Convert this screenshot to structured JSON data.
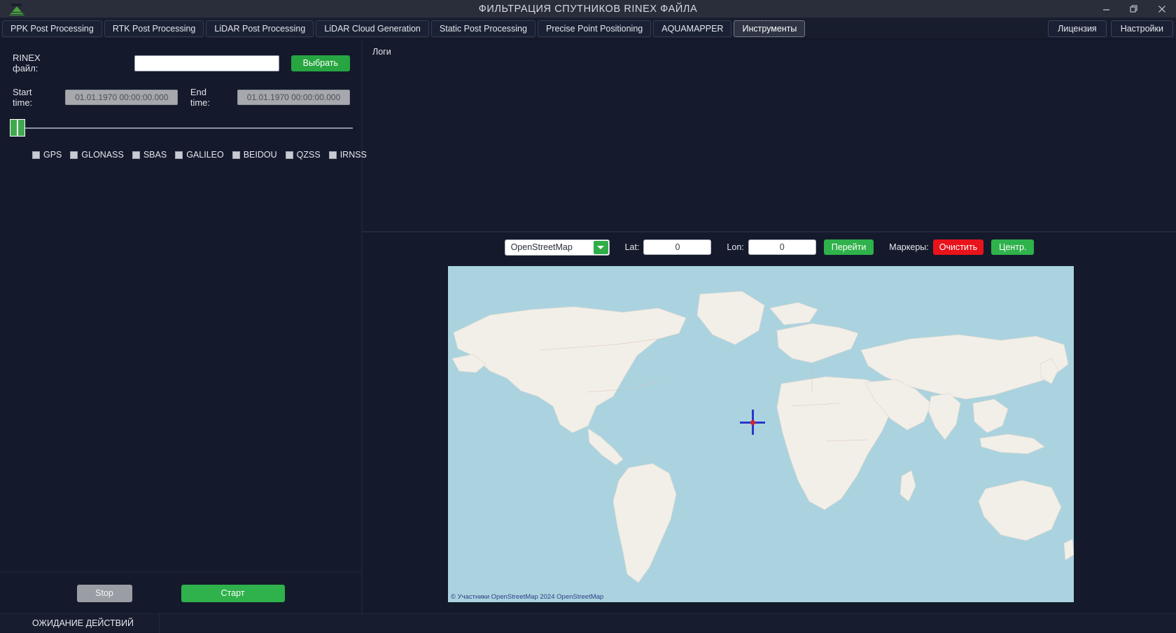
{
  "window": {
    "title": "ФИЛЬТРАЦИЯ СПУТНИКОВ RINEX ФАЙЛА",
    "logo_icon": "mountain-logo-icon",
    "controls": [
      {
        "name": "minimize",
        "icon": "minimize-icon"
      },
      {
        "name": "restore",
        "icon": "restore-icon"
      },
      {
        "name": "close",
        "icon": "close-icon"
      }
    ]
  },
  "tabs": [
    {
      "label": "PPK Post Processing",
      "active": false
    },
    {
      "label": "RTK Post Processing",
      "active": false
    },
    {
      "label": "LiDAR Post Processing",
      "active": false
    },
    {
      "label": "LiDAR Cloud Generation",
      "active": false
    },
    {
      "label": "Static Post Processing",
      "active": false
    },
    {
      "label": "Precise Point Positioning",
      "active": false
    },
    {
      "label": "AQUAMAPPER",
      "active": false
    },
    {
      "label": "Инструменты",
      "active": true
    }
  ],
  "top_right_buttons": [
    {
      "label": "Лицензия"
    },
    {
      "label": "Настройки"
    }
  ],
  "left_panel": {
    "file_label": "RINEX файл:",
    "file_value": "",
    "file_placeholder": "",
    "choose_button": "Выбрать",
    "start_time_label": "Start time:",
    "start_time_value": "01.01.1970 00:00:00.000",
    "end_time_label": "End time:",
    "end_time_value": "01.01.1970 00:00:00.000",
    "slider": {
      "low": 0,
      "high": 0
    },
    "constellations": [
      {
        "label": "GPS",
        "checked": false
      },
      {
        "label": "GLONASS",
        "checked": false
      },
      {
        "label": "SBAS",
        "checked": false
      },
      {
        "label": "GALILEO",
        "checked": false
      },
      {
        "label": "BEIDOU",
        "checked": false
      },
      {
        "label": "QZSS",
        "checked": false
      },
      {
        "label": "IRNSS",
        "checked": false
      }
    ],
    "stop_button": "Stop",
    "start_button": "Старт"
  },
  "logs": {
    "title": "Логи",
    "entries": []
  },
  "map": {
    "provider_selected": "OpenStreetMap",
    "provider_options": [
      "OpenStreetMap"
    ],
    "lat_label": "Lat:",
    "lat_value": "0",
    "lon_label": "Lon:",
    "lon_value": "0",
    "goto_button": "Перейти",
    "markers_label": "Маркеры:",
    "clear_button": "Очистить",
    "center_button": "Центр.",
    "attribution": "© Участники OpenStreetMap 2024 OpenStreetMap",
    "marker_icon": "crosshair-icon",
    "marker_position": {
      "lat": 0,
      "lon": 0
    }
  },
  "status": {
    "text": "ОЖИДАНИЕ ДЕЙСТВИЙ"
  },
  "colors": {
    "accent_green": "#2fb14b",
    "danger_red": "#e8131b",
    "panel_bg": "#141a2b",
    "titlebar_bg": "#2a2e3b",
    "map_water": "#aad3df",
    "map_land": "#f2efe9"
  }
}
